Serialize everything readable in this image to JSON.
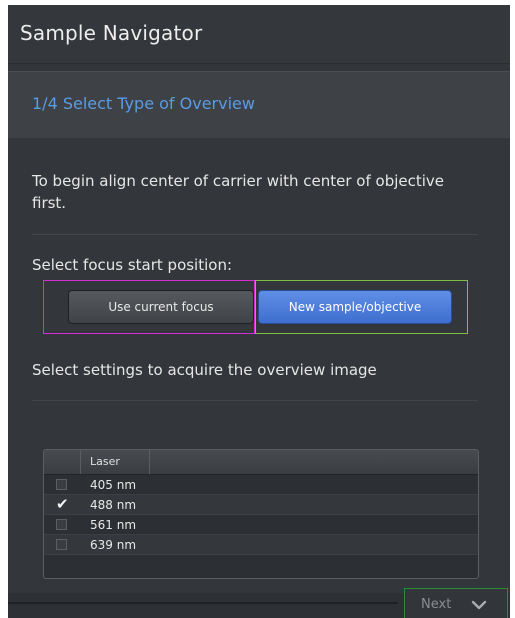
{
  "window": {
    "title": "Sample Navigator"
  },
  "step": {
    "label": "1/4  Select Type of Overview"
  },
  "instructions": {
    "intro": "To begin align center of carrier with center of objective first.",
    "focus_label": "Select focus start position:",
    "settings_label": "Select settings to acquire the overview image"
  },
  "focus_buttons": {
    "current": "Use current focus",
    "new": "New sample/objective",
    "selected": "new"
  },
  "laser_table": {
    "column": "Laser",
    "rows": [
      {
        "label": "405 nm",
        "checked": false
      },
      {
        "label": "488 nm",
        "checked": true
      },
      {
        "label": "561 nm",
        "checked": false
      },
      {
        "label": "639 nm",
        "checked": false
      }
    ]
  },
  "footer": {
    "next_label": "Next"
  },
  "colors": {
    "accent": "#5b9ce2",
    "button_primary": "#4a7ddd",
    "highlight_magenta": "#d62cd6",
    "highlight_green": "#7bc043",
    "next_border": "#2e8b2e"
  },
  "icons": {
    "next": "chevron-down-icon",
    "checkmark": "checkmark-icon"
  }
}
